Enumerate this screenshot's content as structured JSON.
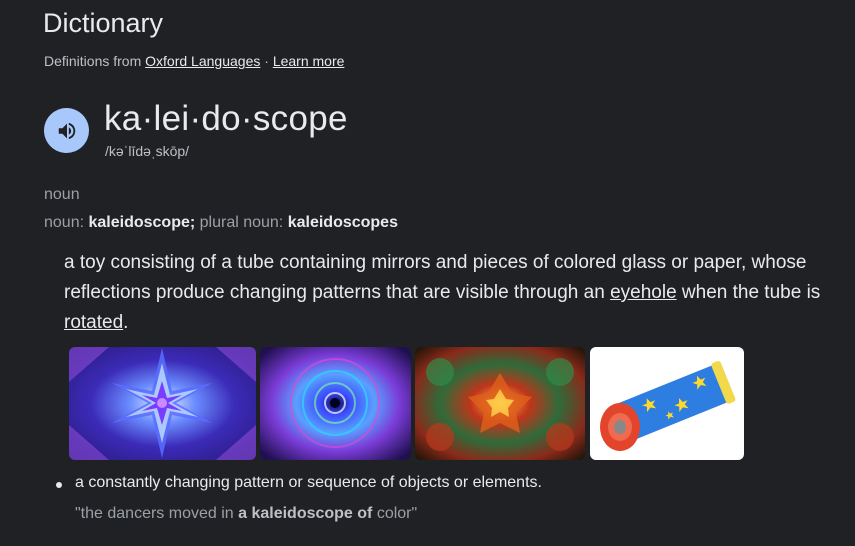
{
  "header": {
    "title": "Dictionary",
    "source_prefix": "Definitions from ",
    "source_link": "Oxford Languages",
    "separator": " · ",
    "learn_more": "Learn more"
  },
  "entry": {
    "headword": "ka·lei·do·scope",
    "phonetic": "/kəˈlīdəˌskōp/",
    "part_of_speech": "noun",
    "forms": {
      "label1": "noun: ",
      "value1": "kaleidoscope;",
      "label2": " plural noun: ",
      "value2": "kaleidoscopes"
    }
  },
  "definition1": {
    "text_before": "a toy consisting of a tube containing mirrors and pieces of colored glass or paper, whose reflections produce changing patterns that are visible through an ",
    "link1": "eyehole",
    "text_middle": " when the tube is ",
    "link2": "rotated",
    "text_end": "."
  },
  "images": [
    {
      "name": "kaleidoscope-star-image",
      "desc": "blue purple star kaleidoscope"
    },
    {
      "name": "kaleidoscope-mandala-image",
      "desc": "blue mandala kaleidoscope"
    },
    {
      "name": "kaleidoscope-colorful-image",
      "desc": "red green kaleidoscope"
    },
    {
      "name": "kaleidoscope-toy-image",
      "desc": "toy kaleidoscope tube"
    }
  ],
  "definition2": {
    "text": "a constantly changing pattern or sequence of objects or elements.",
    "example_open": "\"the dancers moved in ",
    "example_bold": "a kaleidoscope of",
    "example_close": " color\""
  },
  "colors": {
    "background": "#202124",
    "speaker_button": "#a8c7fa",
    "text_primary": "#e8eaed",
    "text_secondary": "#9aa0a6"
  }
}
